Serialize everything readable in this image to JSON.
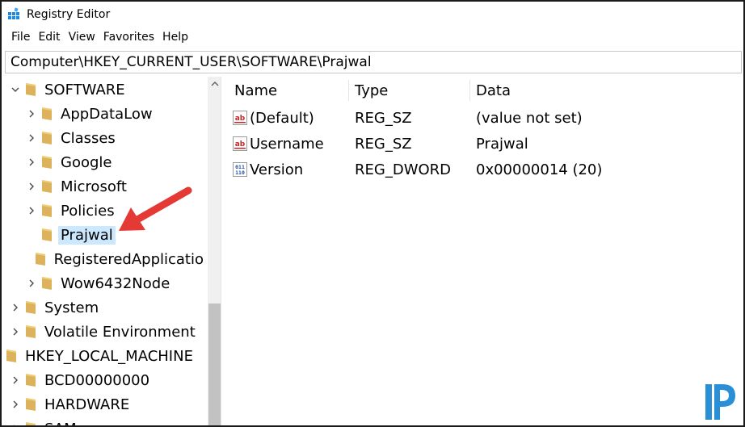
{
  "window": {
    "title": "Registry Editor"
  },
  "menu": [
    "File",
    "Edit",
    "View",
    "Favorites",
    "Help"
  ],
  "address": "Computer\\HKEY_CURRENT_USER\\SOFTWARE\\Prajwal",
  "tree": [
    {
      "label": "SOFTWARE",
      "level": 1,
      "chevron": "down",
      "selected": false
    },
    {
      "label": "AppDataLow",
      "level": 2,
      "chevron": "right",
      "selected": false
    },
    {
      "label": "Classes",
      "level": 2,
      "chevron": "right",
      "selected": false
    },
    {
      "label": "Google",
      "level": 2,
      "chevron": "right",
      "selected": false
    },
    {
      "label": "Microsoft",
      "level": 2,
      "chevron": "right",
      "selected": false
    },
    {
      "label": "Policies",
      "level": 2,
      "chevron": "right",
      "selected": false
    },
    {
      "label": "Prajwal",
      "level": 2,
      "chevron": "none",
      "selected": true
    },
    {
      "label": "RegisteredApplicatio",
      "level": 2,
      "chevron": "none",
      "selected": false
    },
    {
      "label": "Wow6432Node",
      "level": 2,
      "chevron": "right",
      "selected": false
    },
    {
      "label": "System",
      "level": 1,
      "chevron": "right",
      "selected": false
    },
    {
      "label": "Volatile Environment",
      "level": 1,
      "chevron": "right",
      "selected": false
    },
    {
      "label": "HKEY_LOCAL_MACHINE",
      "level": 0,
      "chevron": "down",
      "selected": false
    },
    {
      "label": "BCD00000000",
      "level": 1,
      "chevron": "right",
      "selected": false
    },
    {
      "label": "HARDWARE",
      "level": 1,
      "chevron": "right",
      "selected": false
    },
    {
      "label": "SAM",
      "level": 1,
      "chevron": "right",
      "selected": false
    }
  ],
  "columns": {
    "name": "Name",
    "type": "Type",
    "data": "Data"
  },
  "values": [
    {
      "name": "(Default)",
      "type": "REG_SZ",
      "data": "(value not set)",
      "icon": "string-value-icon"
    },
    {
      "name": "Username",
      "type": "REG_SZ",
      "data": "Prajwal",
      "icon": "string-value-icon"
    },
    {
      "name": "Version",
      "type": "REG_DWORD",
      "data": "0x00000014 (20)",
      "icon": "binary-value-icon"
    }
  ],
  "colors": {
    "selection": "#cce8ff",
    "folder": "#dcb35c",
    "arrow": "#e53935",
    "logo": "#2a8fd6"
  }
}
